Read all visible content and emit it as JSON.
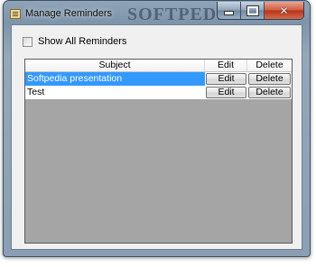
{
  "window": {
    "title": "Manage Reminders",
    "watermark": "SOFTPEDIA",
    "controls": {
      "minimize": "–",
      "maximize": "□",
      "close": "✕"
    }
  },
  "options": {
    "show_all_label": "Show All Reminders",
    "show_all_checked": false
  },
  "table": {
    "columns": [
      "Subject",
      "Edit",
      "Delete"
    ],
    "rows": [
      {
        "subject": "Softpedia presentation",
        "edit": "Edit",
        "delete": "Delete",
        "selected": true
      },
      {
        "subject": "Test",
        "edit": "Edit",
        "delete": "Delete",
        "selected": false
      }
    ]
  },
  "colors": {
    "selection": "#3399ff",
    "empty_area": "#a5a5a5",
    "client_bg": "#f0f0f0"
  }
}
